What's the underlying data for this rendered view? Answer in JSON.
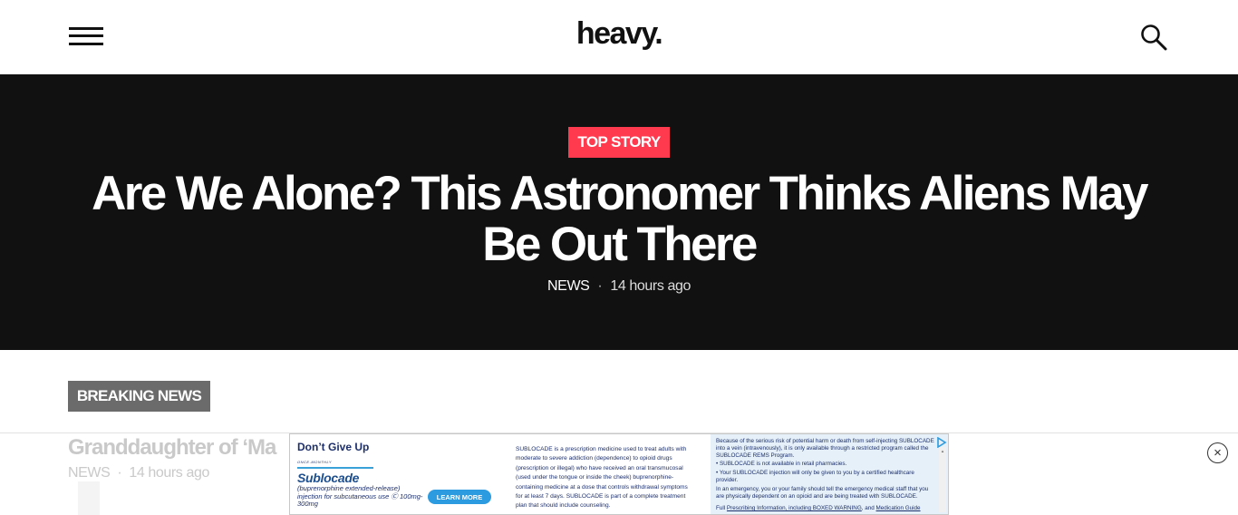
{
  "header": {
    "logo_text": "heavy.",
    "menu_icon": "hamburger-menu-icon",
    "search_icon": "search-icon"
  },
  "hero": {
    "badge": "TOP STORY",
    "title": "Are We Alone? This Astronomer Thinks Aliens May Be Out There",
    "category": "NEWS",
    "separator": "·",
    "time": "14 hours ago",
    "background_color": "#111111",
    "badge_color": "#ff3a4f"
  },
  "breaking": {
    "badge": "BREAKING NEWS",
    "badge_color": "#6b6b6b",
    "story_title": "Granddaughter of ‘Ma",
    "story_category": "NEWS",
    "story_separator": "·",
    "story_time": "14 hours ago"
  },
  "ad": {
    "headline": "Don’t Give Up",
    "once_monthly": "ONCE-MONTHLY",
    "brand": "Sublocade",
    "brand_sub": "(buprenorphine extended-release) injection for subcutaneous use Ⓒ 100mg-300mg",
    "cta": "LEARN MORE",
    "description": "SUBLOCADE is a prescription medicine used to treat adults with moderate to severe addiction (dependence) to opioid drugs (prescription or illegal) who have received an oral transmucosal (used under the tongue or inside the cheek) buprenorphine-containing medicine at a dose that controls withdrawal symptoms for at least 7 days. SUBLOCADE is part of a complete treatment plan that should include counseling.",
    "safety_1": "Because of the serious risk of potential harm or death from self-injecting SUBLOCADE into a vein (intravenously), it is only available through a restricted program called the SUBLOCADE REMS Program.",
    "safety_2": "• SUBLOCADE is not available in retail pharmacies.",
    "safety_3": "• Your SUBLOCADE injection will only be given to you by a certified healthcare provider.",
    "safety_4": "In an emergency, you or your family should tell the emergency medical staff that you are physically dependent on an opioid and are being treated with SUBLOCADE.",
    "footer_prefix": "Full ",
    "footer_link_1": "Prescribing Information, including BOXED WARNING",
    "footer_mid": ", and ",
    "footer_link_2": "Medication Guide",
    "adchoices_icon": "adchoices-icon",
    "close_icon": "close-icon",
    "close_glyph": "×"
  }
}
